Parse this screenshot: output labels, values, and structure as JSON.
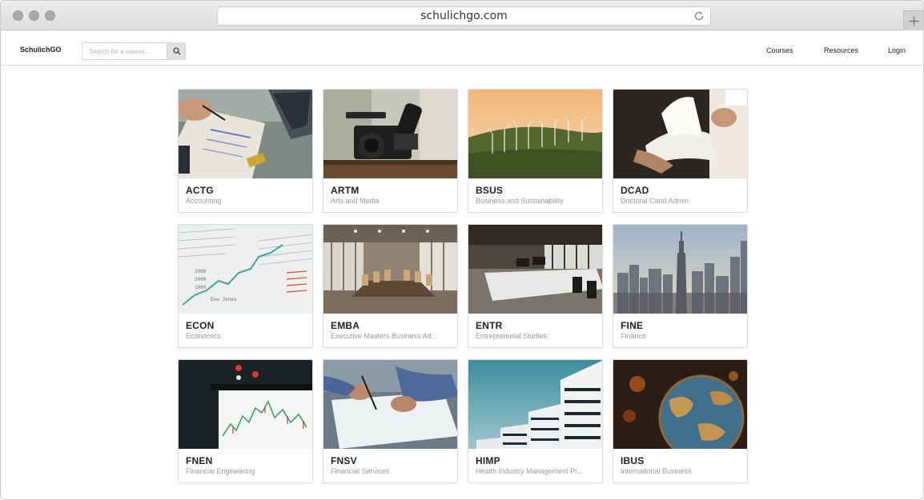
{
  "browser": {
    "url": "schulichgo.com"
  },
  "header": {
    "logo": "SchulichGO",
    "search_placeholder": "Search for a course...",
    "nav": [
      "Courses",
      "Resources",
      "Login"
    ]
  },
  "courses": [
    {
      "code": "ACTG",
      "name": "Accounting",
      "image": "accounting-paperwork-photo"
    },
    {
      "code": "ARTM",
      "name": "Arts and Media",
      "image": "video-camera-photo"
    },
    {
      "code": "BSUS",
      "name": "Business and Sustainability",
      "image": "wind-turbines-photo"
    },
    {
      "code": "DCAD",
      "name": "Doctoral Cand Admin",
      "image": "reading-book-photo"
    },
    {
      "code": "ECON",
      "name": "Economics",
      "image": "stock-newspaper-photo"
    },
    {
      "code": "EMBA",
      "name": "Executive Masters Business Ad...",
      "image": "boardroom-photo"
    },
    {
      "code": "ENTR",
      "name": "Entreprenurial Studies",
      "image": "open-office-photo"
    },
    {
      "code": "FINE",
      "name": "Finance",
      "image": "city-skyline-photo"
    },
    {
      "code": "FNEN",
      "name": "Financial Engineering",
      "image": "trading-chart-photo"
    },
    {
      "code": "FNSV",
      "name": "Financial Services",
      "image": "signing-document-photo"
    },
    {
      "code": "HIMP",
      "name": "Health Industry Management Pr...",
      "image": "white-building-photo"
    },
    {
      "code": "IBUS",
      "name": "International Business",
      "image": "globe-photo"
    }
  ]
}
